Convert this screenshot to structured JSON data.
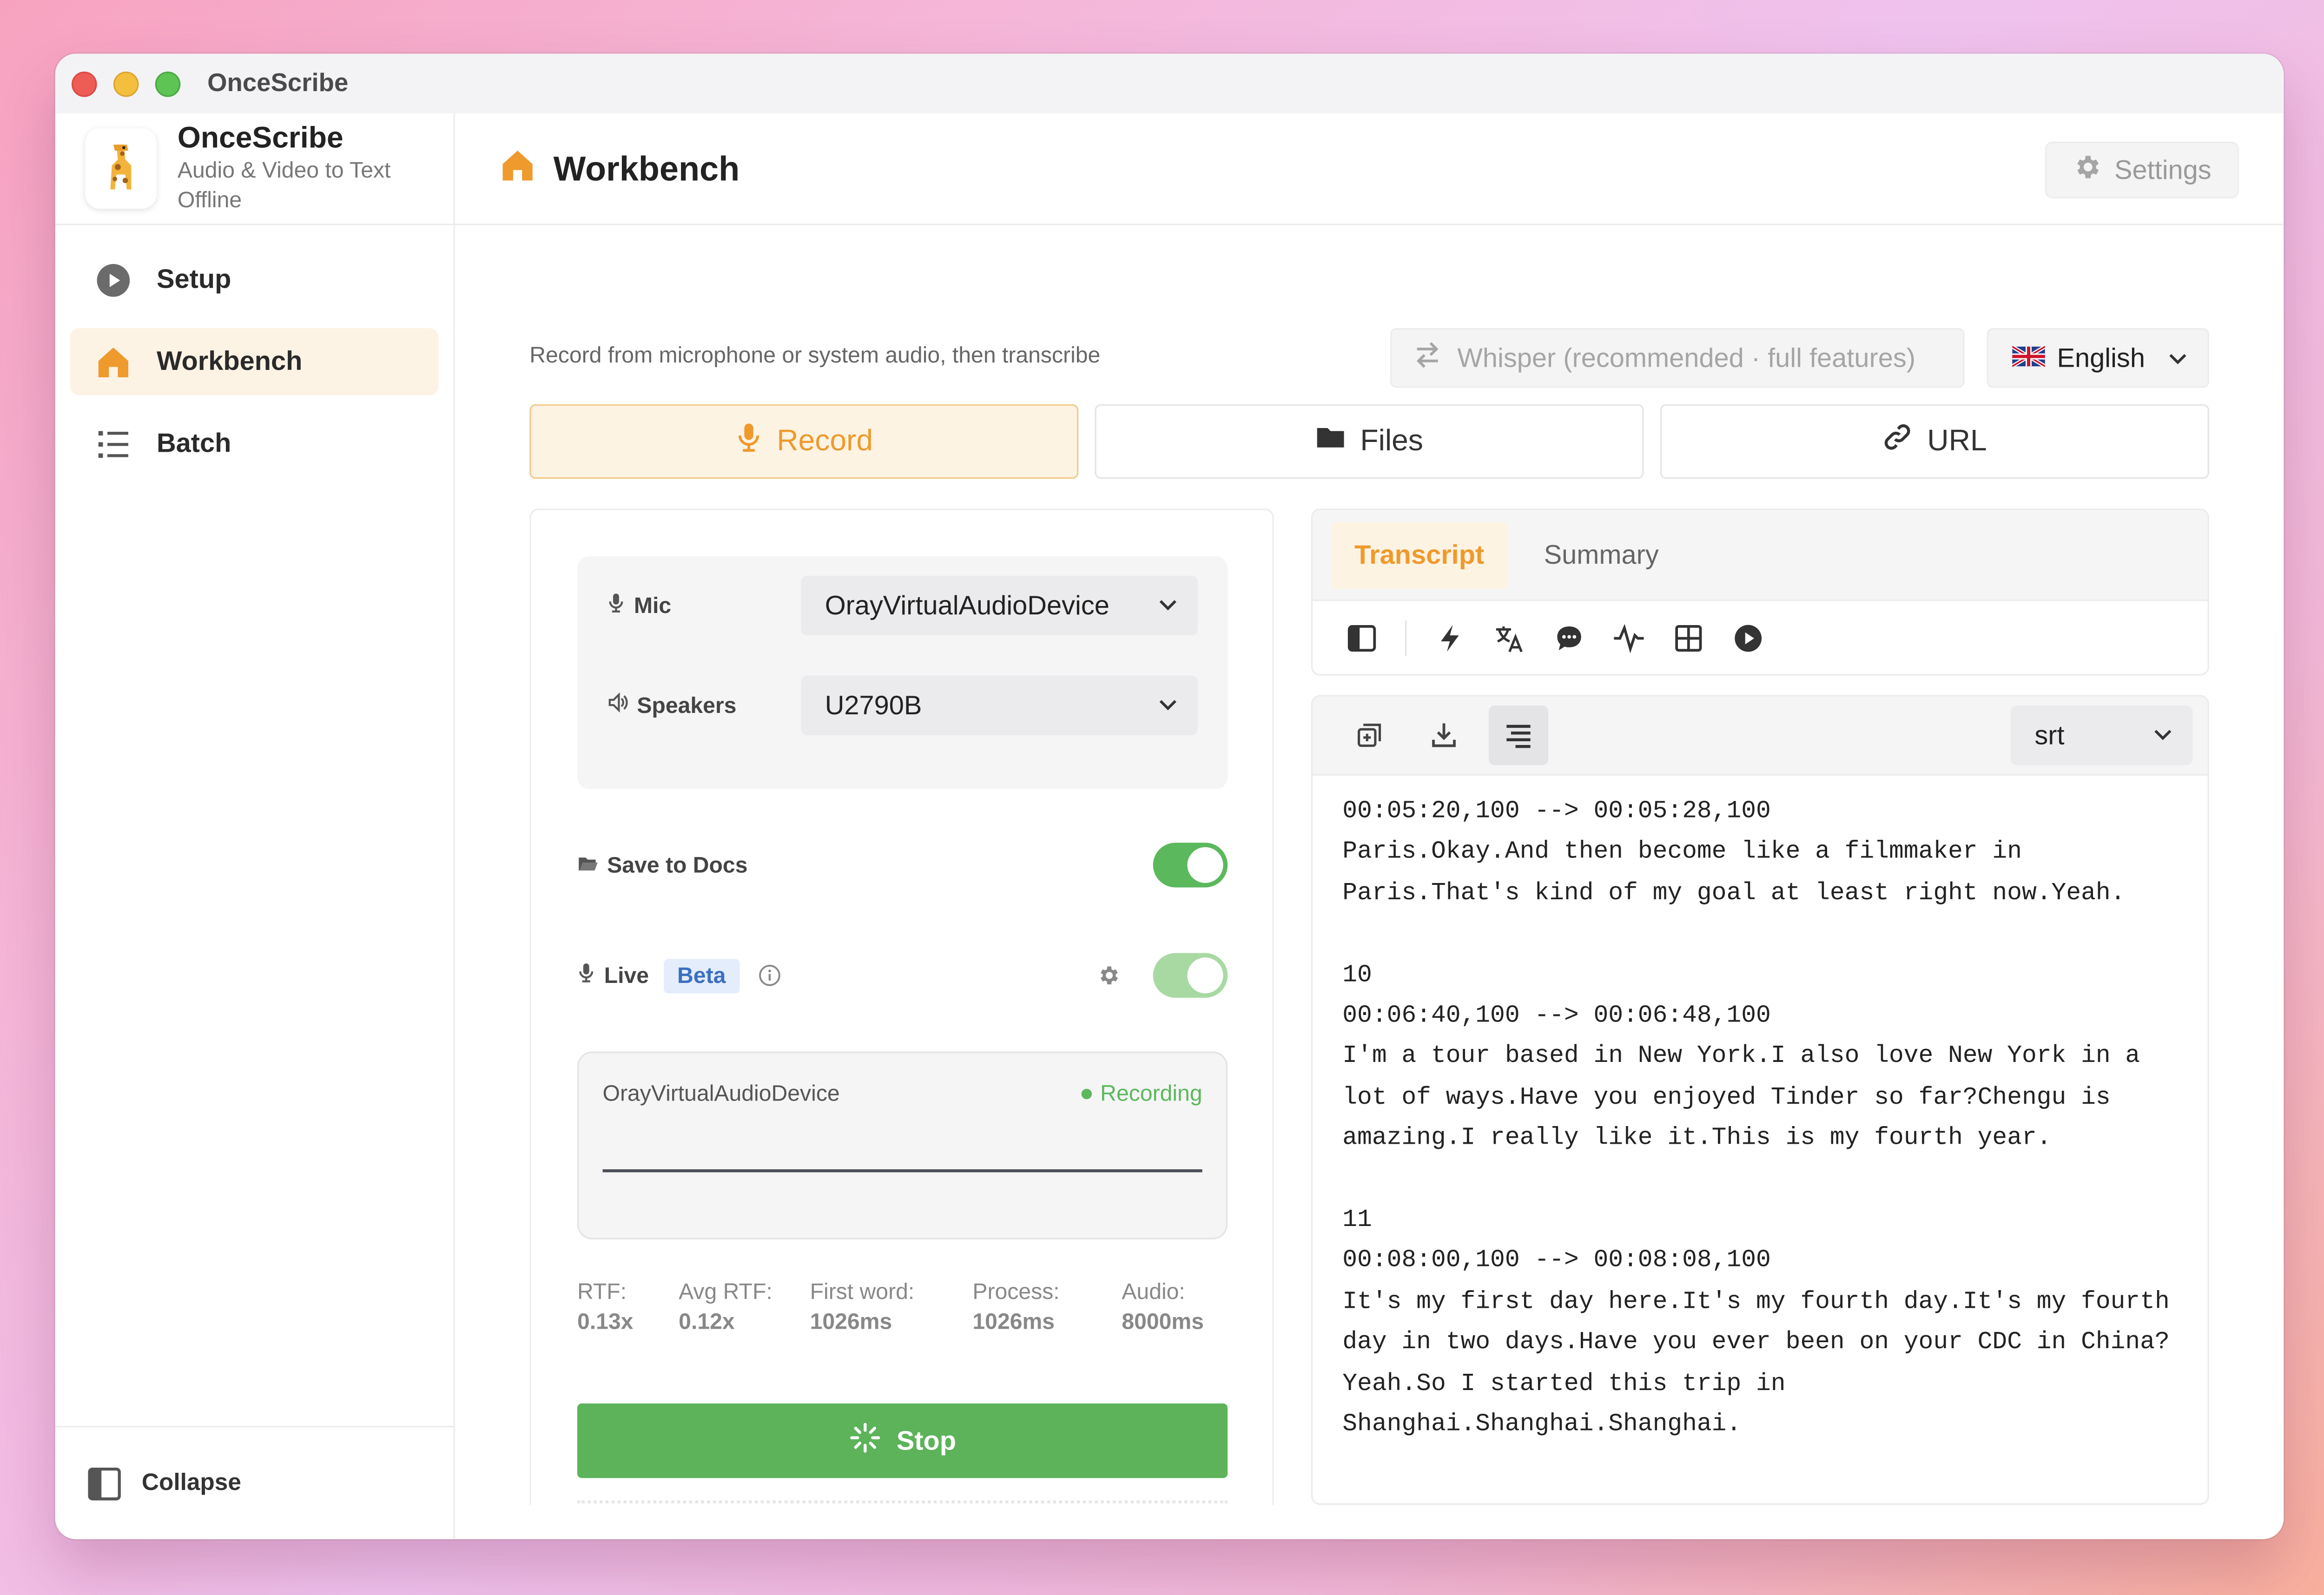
{
  "window": {
    "title": "OnceScribe"
  },
  "brand": {
    "name": "OnceScribe",
    "tagline": "Audio & Video to Text Offline"
  },
  "sidebar": {
    "items": [
      {
        "label": "Setup",
        "icon": "play-circle-icon"
      },
      {
        "label": "Workbench",
        "icon": "home-icon",
        "active": true
      },
      {
        "label": "Batch",
        "icon": "list-icon"
      }
    ],
    "collapse_label": "Collapse"
  },
  "header": {
    "title": "Workbench",
    "settings_label": "Settings"
  },
  "subhead": {
    "description": "Record from microphone or system audio, then transcribe",
    "engine_label": "Whisper (recommended · full features)",
    "language": "English"
  },
  "modes": [
    {
      "label": "Record",
      "icon": "microphone-icon",
      "active": true
    },
    {
      "label": "Files",
      "icon": "folder-icon"
    },
    {
      "label": "URL",
      "icon": "link-icon"
    }
  ],
  "devices": {
    "mic_label": "Mic",
    "mic_value": "OrayVirtualAudioDevice",
    "speakers_label": "Speakers",
    "speakers_value": "U2790B"
  },
  "options": {
    "save_label": "Save to Docs",
    "save_enabled": true,
    "live_label": "Live",
    "beta_badge": "Beta",
    "live_enabled": true
  },
  "recording": {
    "device": "OrayVirtualAudioDevice",
    "status": "Recording"
  },
  "stats": [
    {
      "label": "RTF:",
      "value": "0.13x"
    },
    {
      "label": "Avg RTF:",
      "value": "0.12x"
    },
    {
      "label": "First word:",
      "value": "1026ms"
    },
    {
      "label": "Process:",
      "value": "1026ms"
    },
    {
      "label": "Audio:",
      "value": "8000ms"
    }
  ],
  "stop_label": "Stop",
  "output": {
    "tabs": [
      "Transcript",
      "Summary"
    ],
    "format": "srt",
    "transcript": "00:05:20,100 --> 00:05:28,100\nParis.Okay.And then become like a filmmaker in Paris.That's kind of my goal at least right now.Yeah.\n\n10\n00:06:40,100 --> 00:06:48,100\nI'm a tour based in New York.I also love New York in a lot of ways.Have you enjoyed Tinder so far?Chengu is amazing.I really like it.This is my fourth year.\n\n11\n00:08:00,100 --> 00:08:08,100\nIt's my first day here.It's my fourth day.It's my fourth day in two days.Have you ever been on your CDC in China?Yeah.So I started this trip in Shanghai.Shanghai.Shanghai."
  },
  "colors": {
    "accent": "#ef9a2c",
    "success": "#5cb85c",
    "beta": "#3c6fc2"
  }
}
